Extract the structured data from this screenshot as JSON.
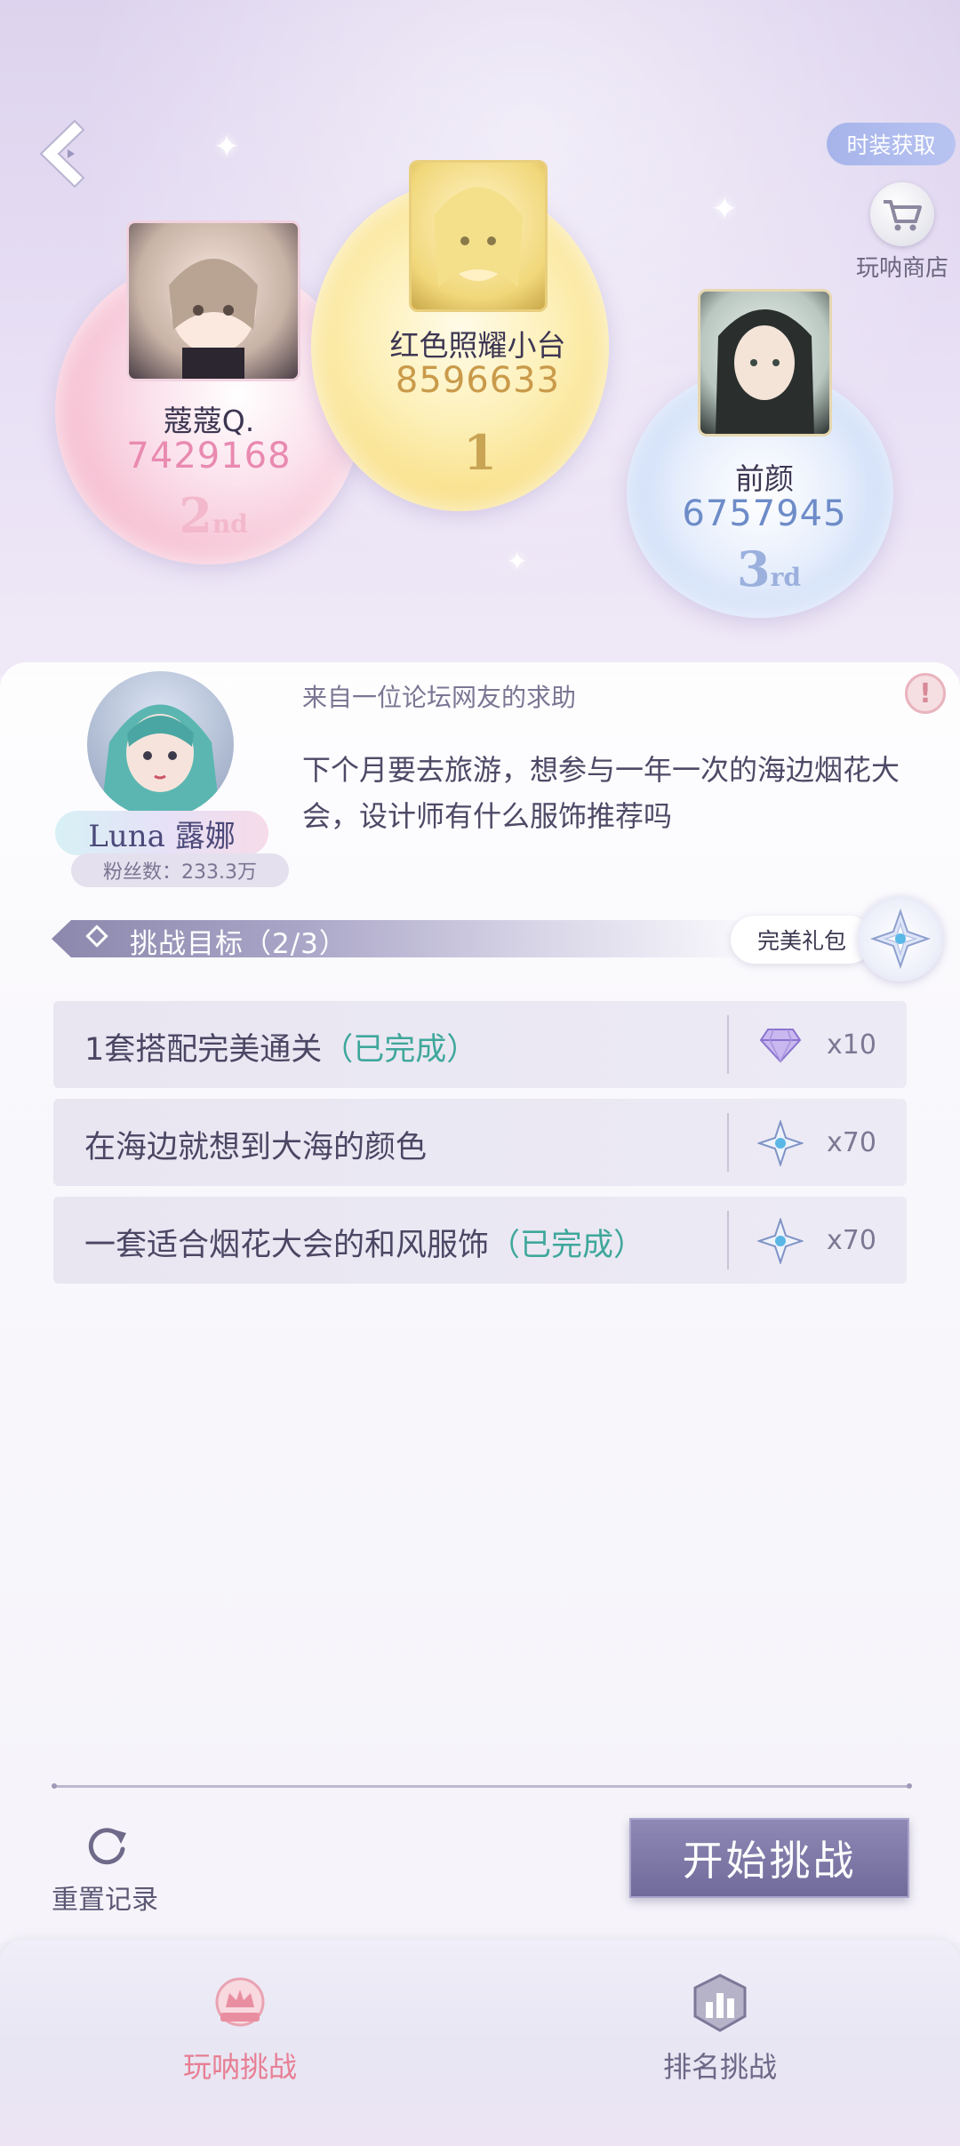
{
  "header": {
    "fashion_get_label": "时装获取",
    "shop_label": "玩呐商店"
  },
  "leaderboard": [
    {
      "rank": "2",
      "rank_suffix": "nd",
      "name": "蔻蔻Q.",
      "score": "7429168",
      "score_color": "#e98ab0"
    },
    {
      "rank": "1",
      "rank_suffix": "",
      "name": "红色照耀小台",
      "score": "8596633",
      "score_color": "#c99a4a"
    },
    {
      "rank": "3",
      "rank_suffix": "rd",
      "name": "前颜",
      "score": "6757945",
      "score_color": "#6d8cc8"
    }
  ],
  "request": {
    "from_label": "来自一位论坛网友的求助",
    "text": "下个月要去旅游，想参与一年一次的海边烟花大会，设计师有什么服饰推荐吗",
    "npc_name": "Luna 露娜",
    "npc_fans": "粉丝数：233.3万"
  },
  "goals": {
    "title": "挑战目标（2/3）",
    "gift_label": "完美礼包",
    "tasks": [
      {
        "text": "1套搭配完美通关",
        "status": "（已完成）",
        "reward_icon": "diamond-icon",
        "qty": "x10"
      },
      {
        "text": "在海边就想到大海的颜色",
        "status": "",
        "reward_icon": "star-badge-icon",
        "qty": "x70"
      },
      {
        "text": "一套适合烟花大会的和风服饰",
        "status": "（已完成）",
        "reward_icon": "star-badge-icon",
        "qty": "x70"
      }
    ]
  },
  "actions": {
    "reset_label": "重置记录",
    "start_label": "开始挑战"
  },
  "nav": {
    "items": [
      {
        "label": "玩呐挑战",
        "active": true,
        "color": "#e77f94"
      },
      {
        "label": "排名挑战",
        "active": false,
        "color": "#6d6887"
      }
    ]
  },
  "colors": {
    "accent": "#7f7aa8",
    "done": "#3fa79b",
    "alert": "#d88a98"
  }
}
